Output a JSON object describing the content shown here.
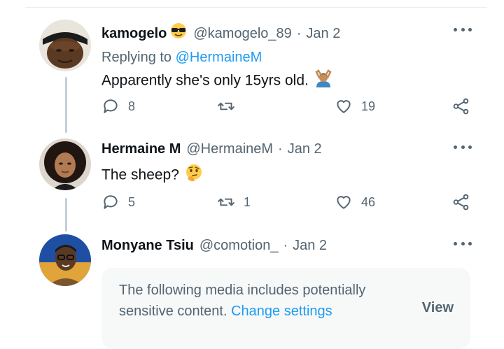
{
  "tweets": [
    {
      "name": "kamogelo",
      "handle": "@kamogelo_89",
      "separator": "·",
      "date": "Jan 2",
      "name_emoji": "smiling-face-with-sunglasses",
      "reply_prefix": "Replying to",
      "reply_mention": "@HermaineM",
      "text": "Apparently she's only 15yrs old.",
      "text_emoji": "person-gesturing-ok",
      "replies": "8",
      "retweets": "",
      "likes": "19"
    },
    {
      "name": "Hermaine M",
      "handle": "@HermaineM",
      "separator": "·",
      "date": "Jan 2",
      "text": "The sheep?",
      "text_emoji": "thinking-face",
      "replies": "5",
      "retweets": "1",
      "likes": "46"
    },
    {
      "name": "Monyane Tsiu",
      "handle": "@comotion_",
      "separator": "·",
      "date": "Jan 2"
    }
  ],
  "sensitive_media": {
    "text": "The following media includes potentially sensitive content.",
    "link": "Change settings",
    "button": "View"
  },
  "colors": {
    "link": "#1d9bf0",
    "secondary_text": "#536471",
    "primary_text": "#0f1419",
    "card_bg": "#f7f9f9"
  }
}
